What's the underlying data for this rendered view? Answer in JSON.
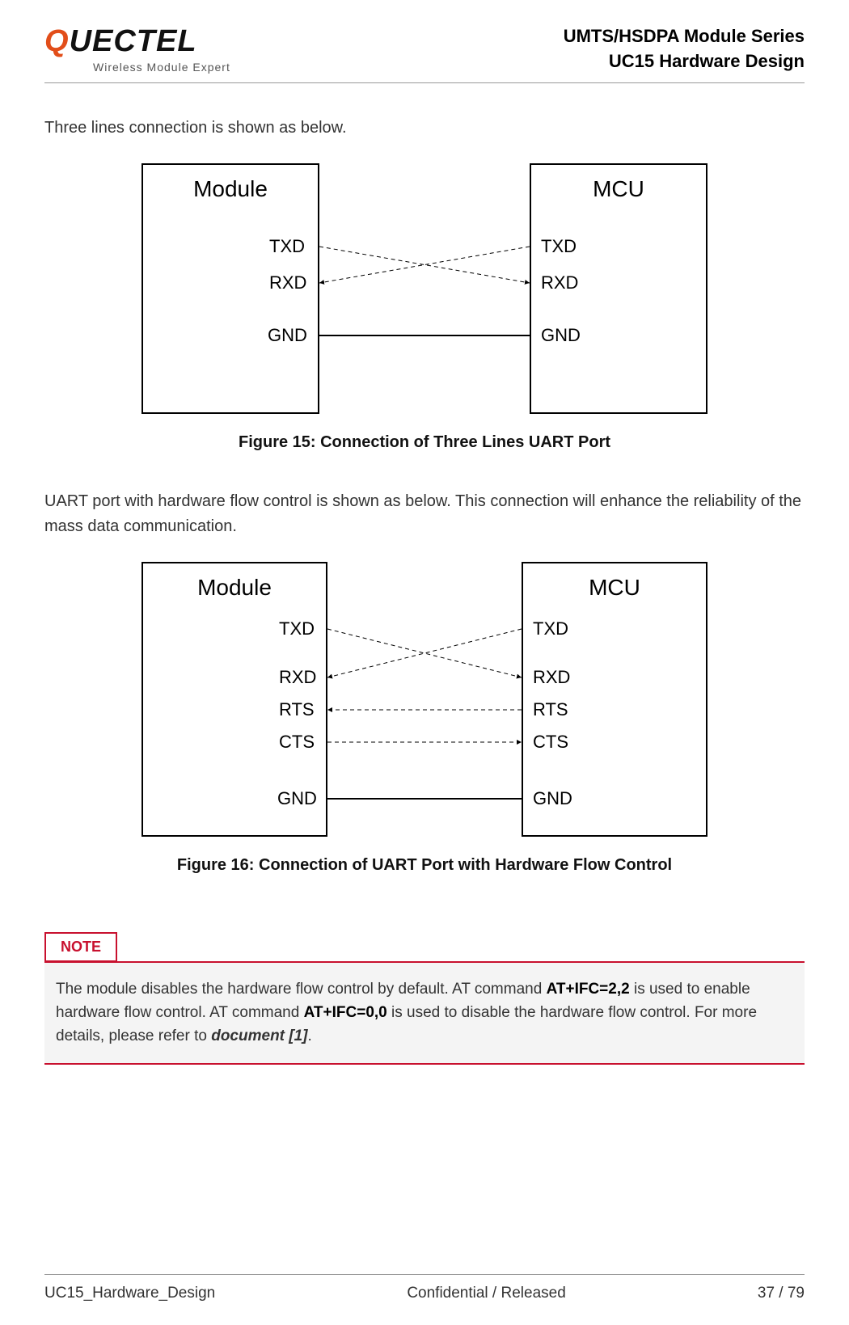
{
  "header": {
    "logo_q": "Q",
    "logo_rest": "UECTEL",
    "logo_sub": "Wireless Module Expert",
    "line1": "UMTS/HSDPA Module Series",
    "line2": "UC15 Hardware Design"
  },
  "intro1": "Three lines connection is shown as below.",
  "fig15": {
    "module_title": "Module",
    "mcu_title": "MCU",
    "pins": {
      "txd": "TXD",
      "rxd": "RXD",
      "gnd": "GND"
    },
    "caption": "Figure 15: Connection of Three Lines UART Port"
  },
  "intro2": "UART port with hardware flow control is shown as below. This connection will enhance the reliability of the mass data communication.",
  "fig16": {
    "module_title": "Module",
    "mcu_title": "MCU",
    "pins": {
      "txd": "TXD",
      "rxd": "RXD",
      "rts": "RTS",
      "cts": "CTS",
      "gnd": "GND"
    },
    "caption": "Figure 16: Connection of UART Port with Hardware Flow Control"
  },
  "note": {
    "tag": "NOTE",
    "text_a": "The module disables the hardware flow control by default. AT command ",
    "cmd1": "AT+IFC=2,2",
    "text_b": " is used to enable hardware flow control. AT command ",
    "cmd2": "AT+IFC=0,0",
    "text_c": " is used to disable the hardware flow control. For more details, please refer to ",
    "ref": "document [1]",
    "text_d": "."
  },
  "footer": {
    "left": "UC15_Hardware_Design",
    "center": "Confidential / Released",
    "right": "37 / 79"
  }
}
